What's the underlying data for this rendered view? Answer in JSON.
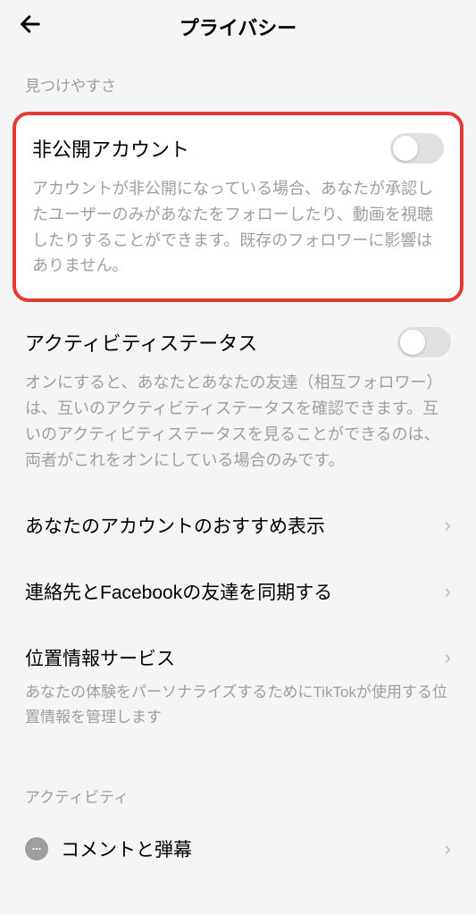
{
  "header": {
    "title": "プライバシー"
  },
  "sections": {
    "discoverability": {
      "label": "見つけやすさ",
      "privateAccount": {
        "title": "非公開アカウント",
        "description": "アカウントが非公開になっている場合、あなたが承認したユーザーのみがあなたをフォローしたり、動画を視聴したりすることができます。既存のフォロワーに影響はありません。"
      },
      "activityStatus": {
        "title": "アクティビティステータス",
        "description": "オンにすると、あなたとあなたの友達（相互フォロワー）は、互いのアクティビティステータスを確認できます。互いのアクティビティステータスを見ることができるのは、両者がこれをオンにしている場合のみです。"
      },
      "suggestAccount": {
        "title": "あなたのアカウントのおすすめ表示"
      },
      "syncContacts": {
        "title": "連絡先とFacebookの友達を同期する"
      },
      "locationServices": {
        "title": "位置情報サービス",
        "description": "あなたの体験をパーソナライズするためにTikTokが使用する位置情報を管理します"
      }
    },
    "activity": {
      "label": "アクティビティ",
      "comments": {
        "title": "コメントと弾幕"
      }
    }
  }
}
